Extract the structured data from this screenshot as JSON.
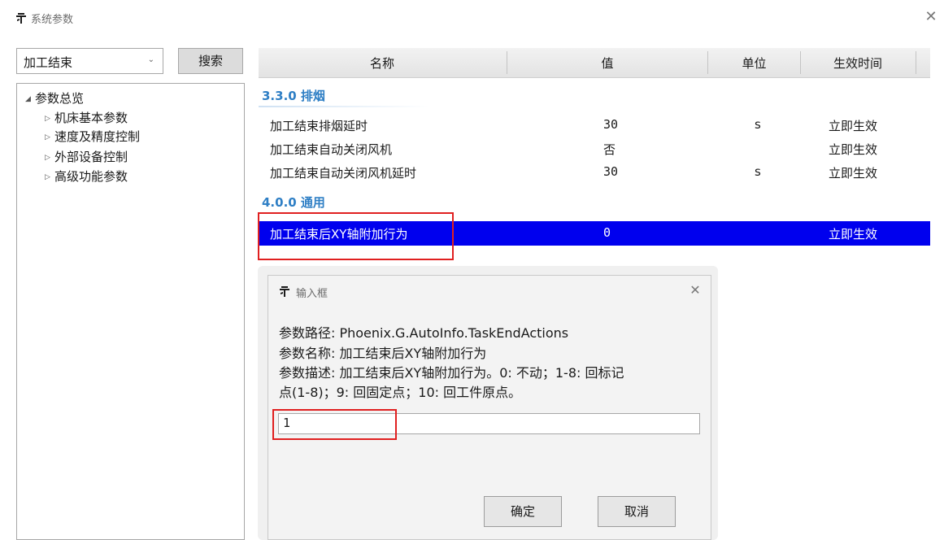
{
  "window": {
    "title": "系统参数",
    "icon": "app-logo-icon",
    "close_glyph": "✕"
  },
  "search": {
    "selected": "加工结束",
    "button_label": "搜索"
  },
  "tree": {
    "root": "参数总览",
    "children": [
      "机床基本参数",
      "速度及精度控制",
      "外部设备控制",
      "高级功能参数"
    ]
  },
  "table": {
    "headers": {
      "name": "名称",
      "value": "值",
      "unit": "单位",
      "effect": "生效时间"
    },
    "sections": [
      {
        "title": "3.3.0 排烟",
        "rows": [
          {
            "name": "加工结束排烟延时",
            "value": "30",
            "unit": "s",
            "effect": "立即生效"
          },
          {
            "name": "加工结束自动关闭风机",
            "value": "否",
            "unit": "",
            "effect": "立即生效"
          },
          {
            "name": "加工结束自动关闭风机延时",
            "value": "30",
            "unit": "s",
            "effect": "立即生效"
          }
        ]
      },
      {
        "title": "4.0.0 通用",
        "rows": [
          {
            "name": "加工结束后XY轴附加行为",
            "value": "0",
            "unit": "",
            "effect": "立即生效",
            "selected": true
          }
        ]
      }
    ]
  },
  "dialog": {
    "title": "输入框",
    "path_line": "参数路径: Phoenix.G.AutoInfo.TaskEndActions",
    "name_line": "参数名称: 加工结束后XY轴附加行为",
    "desc_line1": "参数描述: 加工结束后XY轴附加行为。0: 不动；1-8: 回标记",
    "desc_line2": "点(1-8)；9: 回固定点；10: 回工件原点。",
    "input_value": "1",
    "ok_label": "确定",
    "cancel_label": "取消",
    "close_glyph": "✕"
  },
  "colors": {
    "selection": "#0000ee",
    "section_title": "#2f7fc5",
    "highlight_box": "#e02020"
  }
}
